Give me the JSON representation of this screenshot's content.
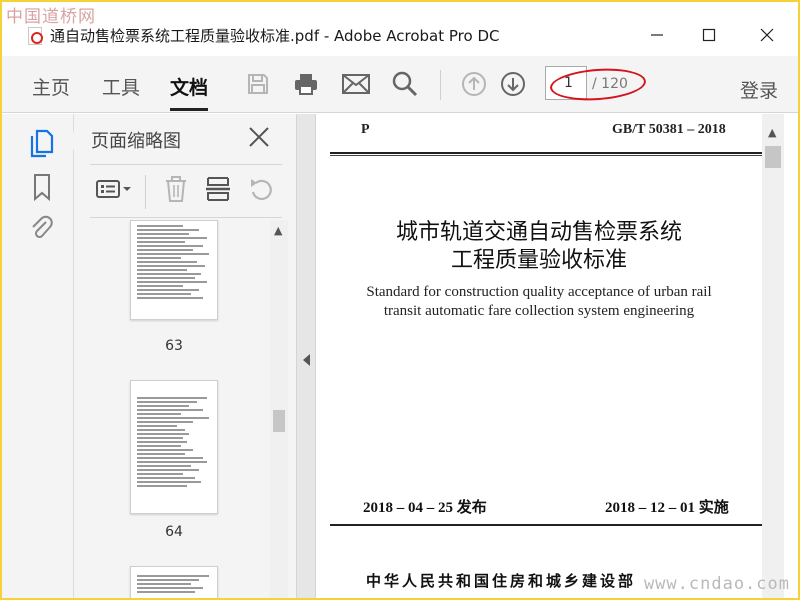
{
  "watermark": {
    "top": "中国道桥网",
    "bottom": "www.cndao.com"
  },
  "window": {
    "title": "通自动售检票系统工程质量验收标准.pdf - Adobe Acrobat Pro DC",
    "controls": [
      "minimize-icon",
      "maximize-icon",
      "close-icon"
    ]
  },
  "toolbar": {
    "tabs": [
      {
        "label": "主页",
        "active": false
      },
      {
        "label": "工具",
        "active": false
      },
      {
        "label": "文档",
        "active": true
      }
    ],
    "icons": [
      "save-icon",
      "print-icon",
      "email-icon",
      "search-icon",
      "previous-page-icon",
      "next-page-icon"
    ],
    "page_current": "1",
    "page_total": "/ 120",
    "login_label": "登录",
    "annotation_color": "#d5131a"
  },
  "left_rail": {
    "icons": [
      "page-thumbnails-icon",
      "bookmarks-icon",
      "attachments-icon"
    ],
    "accent": "#1473e6"
  },
  "thumbnail_panel": {
    "title": "页面缩略图",
    "toolbar_icons": [
      "options-menu-icon",
      "delete-icon",
      "extract-icon",
      "rotate-icon"
    ],
    "thumbnails": [
      {
        "page": "63"
      },
      {
        "page": "64"
      },
      {
        "page": ""
      }
    ]
  },
  "document": {
    "header_left": "P",
    "header_right": "GB/T  50381 – 2018",
    "title_line1": "城市轨道交通自动售检票系统",
    "title_line2": "工程质量验收标准",
    "english_line1": "Standard for construction quality acceptance of urban rail",
    "english_line2": "transit automatic fare collection system engineering",
    "issue_date": "2018 – 04 – 25   发布",
    "implement_date": "2018 – 12 – 01   实施",
    "publisher": "中华人民共和国住房和城乡建设部"
  }
}
